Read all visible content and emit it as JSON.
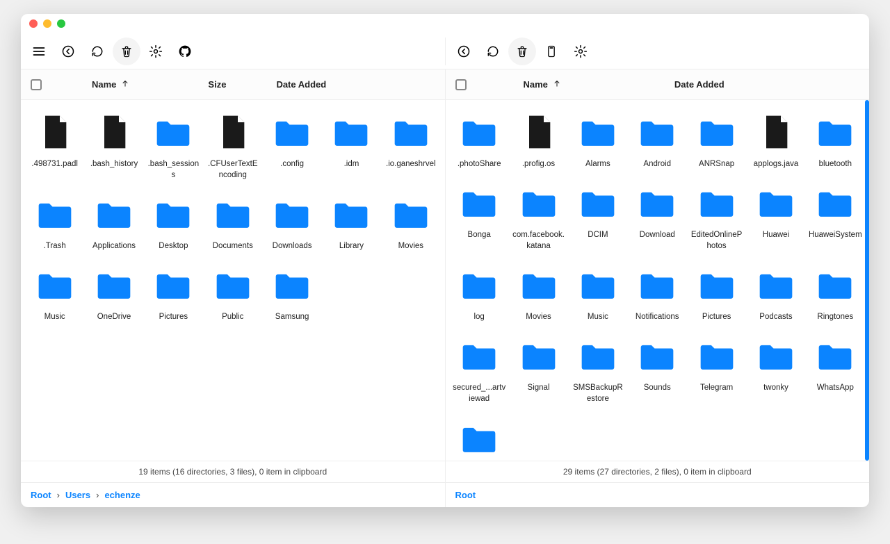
{
  "columns_left": {
    "name": "Name",
    "size": "Size",
    "date": "Date Added"
  },
  "columns_right": {
    "name": "Name",
    "date": "Date Added"
  },
  "left_items": [
    {
      "name": ".498731.padl",
      "type": "file"
    },
    {
      "name": ".bash_history",
      "type": "file"
    },
    {
      "name": ".bash_sessions",
      "type": "folder"
    },
    {
      "name": ".CFUserTextEncoding",
      "type": "file"
    },
    {
      "name": ".config",
      "type": "folder"
    },
    {
      "name": ".idm",
      "type": "folder"
    },
    {
      "name": ".io.ganeshrvel",
      "type": "folder"
    },
    {
      "name": ".Trash",
      "type": "folder"
    },
    {
      "name": "Applications",
      "type": "folder"
    },
    {
      "name": "Desktop",
      "type": "folder"
    },
    {
      "name": "Documents",
      "type": "folder"
    },
    {
      "name": "Downloads",
      "type": "folder"
    },
    {
      "name": "Library",
      "type": "folder"
    },
    {
      "name": "Movies",
      "type": "folder"
    },
    {
      "name": "Music",
      "type": "folder"
    },
    {
      "name": "OneDrive",
      "type": "folder"
    },
    {
      "name": "Pictures",
      "type": "folder"
    },
    {
      "name": "Public",
      "type": "folder"
    },
    {
      "name": "Samsung",
      "type": "folder"
    }
  ],
  "right_items": [
    {
      "name": ".photoShare",
      "type": "folder"
    },
    {
      "name": ".profig.os",
      "type": "file"
    },
    {
      "name": "Alarms",
      "type": "folder"
    },
    {
      "name": "Android",
      "type": "folder"
    },
    {
      "name": "ANRSnap",
      "type": "folder"
    },
    {
      "name": "applogs.java",
      "type": "file"
    },
    {
      "name": "bluetooth",
      "type": "folder"
    },
    {
      "name": "Bonga",
      "type": "folder"
    },
    {
      "name": "com.facebook.katana",
      "type": "folder"
    },
    {
      "name": "DCIM",
      "type": "folder"
    },
    {
      "name": "Download",
      "type": "folder"
    },
    {
      "name": "EditedOnlinePhotos",
      "type": "folder"
    },
    {
      "name": "Huawei",
      "type": "folder"
    },
    {
      "name": "HuaweiSystem",
      "type": "folder"
    },
    {
      "name": "log",
      "type": "folder"
    },
    {
      "name": "Movies",
      "type": "folder"
    },
    {
      "name": "Music",
      "type": "folder"
    },
    {
      "name": "Notifications",
      "type": "folder"
    },
    {
      "name": "Pictures",
      "type": "folder"
    },
    {
      "name": "Podcasts",
      "type": "folder"
    },
    {
      "name": "Ringtones",
      "type": "folder"
    },
    {
      "name": "secured_...artviewad",
      "type": "folder"
    },
    {
      "name": "Signal",
      "type": "folder"
    },
    {
      "name": "SMSBackupRestore",
      "type": "folder"
    },
    {
      "name": "Sounds",
      "type": "folder"
    },
    {
      "name": "Telegram",
      "type": "folder"
    },
    {
      "name": "twonky",
      "type": "folder"
    },
    {
      "name": "WhatsApp",
      "type": "folder"
    }
  ],
  "right_extra_partial": {
    "type": "folder"
  },
  "status": {
    "left": "19 items (16 directories, 3 files), 0 item in clipboard",
    "right": "29 items (27 directories, 2 files), 0 item in clipboard"
  },
  "breadcrumbs": {
    "left": [
      "Root",
      "Users",
      "echenze"
    ],
    "right": [
      "Root"
    ]
  }
}
